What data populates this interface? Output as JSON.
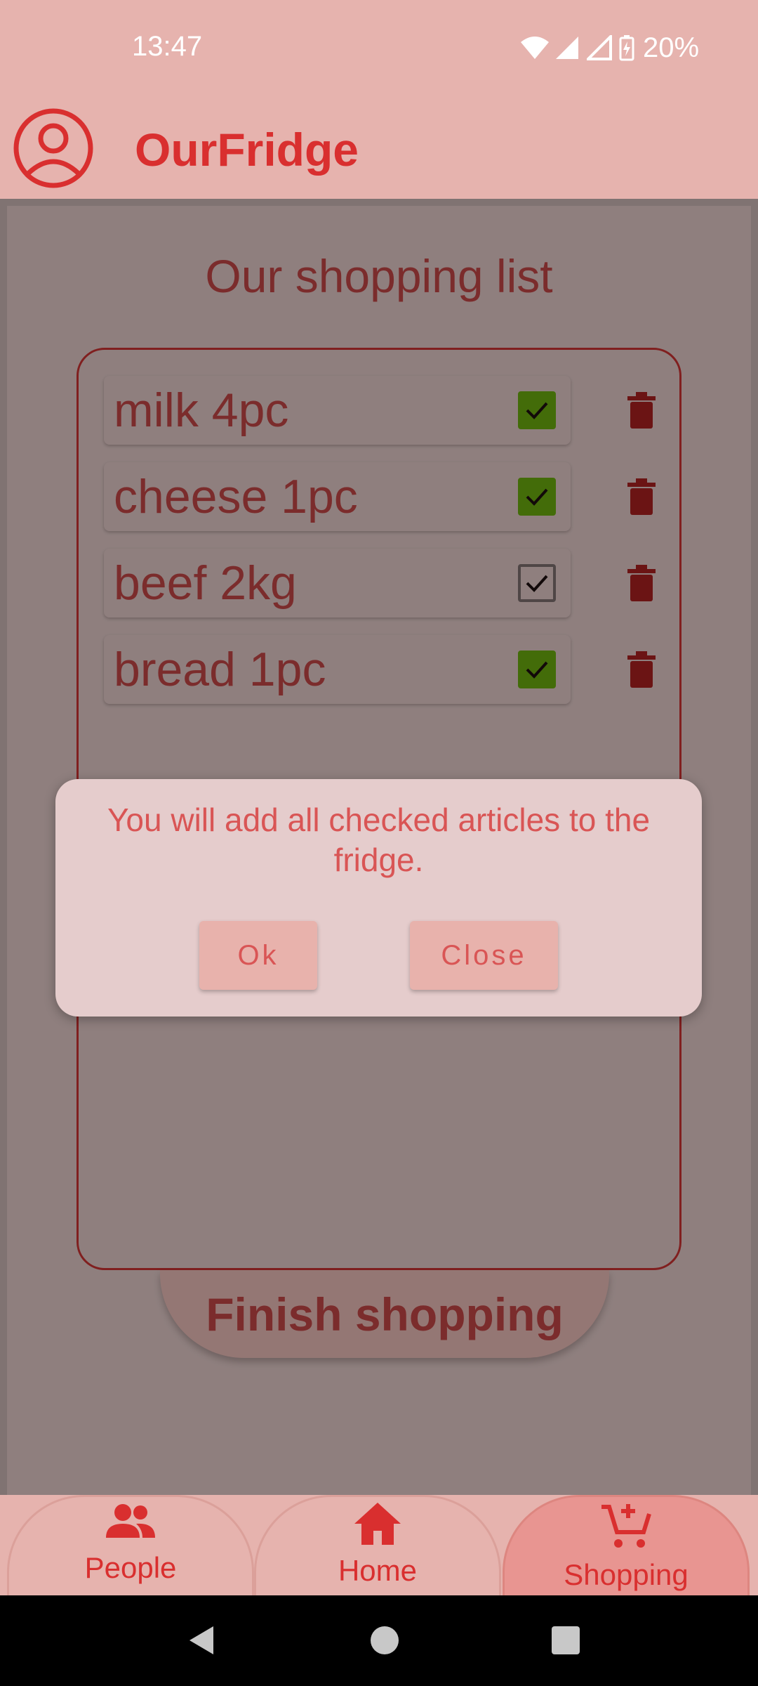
{
  "status_bar": {
    "time": "13:47",
    "battery": "20%",
    "icons": [
      "wifi-icon",
      "signal-icon",
      "battery-charging-icon"
    ]
  },
  "header": {
    "title": "OurFridge",
    "profile_icon": "account-circle-icon"
  },
  "main": {
    "title": "Our shopping list",
    "items": [
      {
        "label": "milk 4pc",
        "checked": true
      },
      {
        "label": "cheese 1pc",
        "checked": true
      },
      {
        "label": "beef 2kg",
        "checked": false
      },
      {
        "label": "bread 1pc",
        "checked": true
      }
    ],
    "finish_label": "Finish shopping"
  },
  "dialog": {
    "message": "You will add all checked articles to the fridge.",
    "ok_label": "Ok",
    "close_label": "Close"
  },
  "nav": {
    "tabs": [
      {
        "label": "People",
        "icon": "people-icon",
        "active": false
      },
      {
        "label": "Home",
        "icon": "home-icon",
        "active": false
      },
      {
        "label": "Shopping",
        "icon": "add-shopping-cart-icon",
        "active": true
      }
    ]
  },
  "colors": {
    "accent": "#d92f2f",
    "surface": "#e6b3ae",
    "checked": "#5ab400"
  }
}
